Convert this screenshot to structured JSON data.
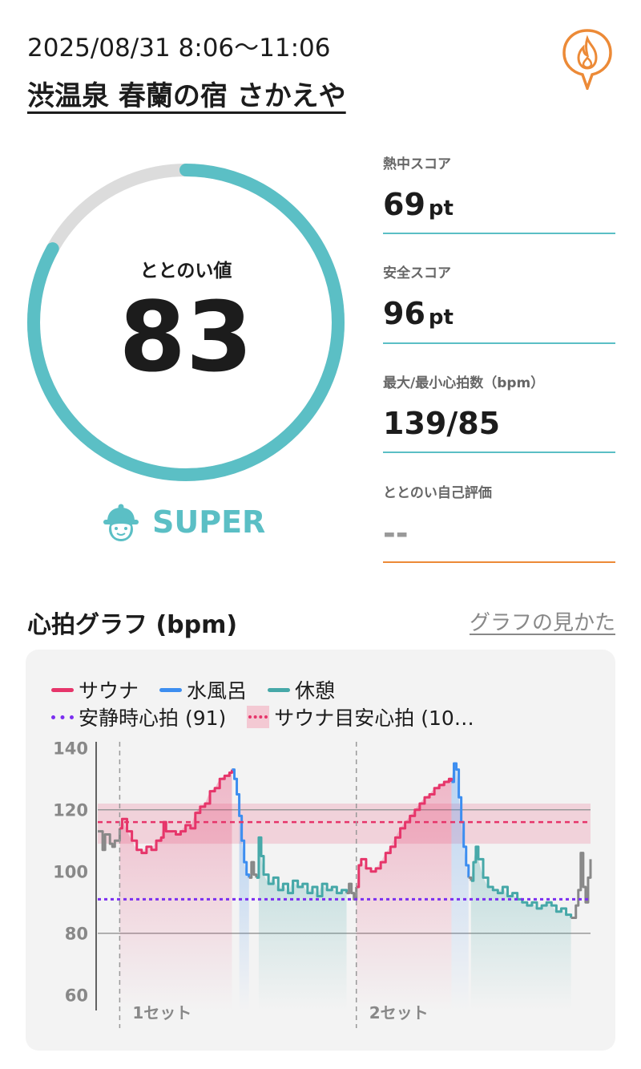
{
  "session": {
    "datetime": "2025/08/31 8:06〜11:06",
    "facility": "渋温泉 春蘭の宿 さかえや"
  },
  "totonoi": {
    "label": "ととのい値",
    "value": "83",
    "fraction": 0.83,
    "rank_label": "SUPER",
    "ring_color": "#5bbfc5",
    "ring_track_color": "#dcdcdc"
  },
  "metrics": [
    {
      "label": "熱中スコア",
      "value": "69",
      "unit": "pt"
    },
    {
      "label": "安全スコア",
      "value": "96",
      "unit": "pt"
    },
    {
      "label": "最大/最小心拍数（bpm）",
      "value": "139/85",
      "unit": ""
    },
    {
      "label": "ととのい自己評価",
      "value": "--",
      "unit": ""
    }
  ],
  "graph": {
    "title": "心拍グラフ (bpm)",
    "help_link": "グラフの見かた"
  },
  "icons": {
    "fire": "fire-pin-icon",
    "rank": "sauna-hat-face-icon"
  },
  "chart_data": {
    "type": "line",
    "ylim": [
      55,
      142
    ],
    "yticks": [
      "140",
      "120",
      "100",
      "80",
      "60"
    ],
    "legend": [
      {
        "name": "サウナ",
        "color": "#e6356a",
        "style": "line"
      },
      {
        "name": "水風呂",
        "color": "#3d8ef0",
        "style": "line"
      },
      {
        "name": "休憩",
        "color": "#46a8a8",
        "style": "line"
      },
      {
        "name": "安静時心拍 (91)",
        "color": "#7b2ff0",
        "style": "dotted"
      },
      {
        "name": "サウナ目安心拍 (10…",
        "color": "#e6356a",
        "style": "band"
      }
    ],
    "resting_hr": 91,
    "sauna_band": [
      109,
      122
    ],
    "sauna_target": 116,
    "reference_lines": [
      120,
      80
    ],
    "set_labels": [
      "1セット",
      "2セット"
    ],
    "series": [
      {
        "name": "pre",
        "color": "#888888",
        "points": [
          [
            0,
            113
          ],
          [
            1,
            107
          ],
          [
            1.5,
            112
          ],
          [
            2.5,
            109
          ],
          [
            3,
            108
          ],
          [
            3.5,
            110
          ],
          [
            4.5,
            114
          ]
        ]
      },
      {
        "name": "サウナ",
        "color": "#e6356a",
        "points": [
          [
            4.5,
            114
          ],
          [
            5,
            117
          ],
          [
            6,
            113
          ],
          [
            7,
            110
          ],
          [
            8,
            107
          ],
          [
            9,
            106
          ],
          [
            10,
            108
          ],
          [
            11,
            107
          ],
          [
            12,
            110
          ],
          [
            13,
            111
          ],
          [
            13.5,
            116
          ],
          [
            14,
            113
          ],
          [
            15,
            113
          ],
          [
            16,
            112
          ],
          [
            17,
            113
          ],
          [
            18,
            115
          ],
          [
            19,
            114
          ],
          [
            20,
            119
          ],
          [
            21,
            121
          ],
          [
            22,
            122
          ],
          [
            23,
            126
          ],
          [
            24,
            127
          ],
          [
            25,
            130
          ],
          [
            26,
            131
          ],
          [
            27,
            132
          ],
          [
            27.5,
            133
          ]
        ]
      },
      {
        "name": "水風呂",
        "color": "#3d8ef0",
        "points": [
          [
            27.5,
            133
          ],
          [
            28,
            130
          ],
          [
            28.5,
            125
          ],
          [
            29,
            118
          ],
          [
            29.5,
            110
          ],
          [
            30,
            103
          ],
          [
            30.5,
            99
          ],
          [
            31,
            98
          ]
        ]
      },
      {
        "name": "mid1",
        "color": "#888888",
        "points": [
          [
            31,
            98
          ],
          [
            31.5,
            103
          ],
          [
            32,
            99
          ],
          [
            32.5,
            98
          ]
        ]
      },
      {
        "name": "休憩",
        "color": "#46a8a8",
        "points": [
          [
            32.5,
            98
          ],
          [
            33,
            111
          ],
          [
            33.5,
            105
          ],
          [
            34,
            99
          ],
          [
            35,
            96
          ],
          [
            36,
            98
          ],
          [
            37,
            94
          ],
          [
            38,
            96
          ],
          [
            39,
            93
          ],
          [
            40,
            97
          ],
          [
            41,
            95
          ],
          [
            42,
            96
          ],
          [
            43,
            93
          ],
          [
            44,
            95
          ],
          [
            45,
            92
          ],
          [
            46,
            96
          ],
          [
            47,
            94
          ],
          [
            48,
            95
          ],
          [
            49,
            93
          ],
          [
            50,
            94
          ],
          [
            51,
            93
          ]
        ]
      },
      {
        "name": "mid2",
        "color": "#888888",
        "points": [
          [
            51,
            93
          ],
          [
            51.5,
            96
          ],
          [
            52,
            93
          ],
          [
            52.5,
            91
          ],
          [
            53,
            95
          ]
        ]
      },
      {
        "name": "サウナ",
        "color": "#e6356a",
        "points": [
          [
            53,
            95
          ],
          [
            53.5,
            102
          ],
          [
            54,
            104
          ],
          [
            55,
            101
          ],
          [
            56,
            100
          ],
          [
            57,
            101
          ],
          [
            58,
            103
          ],
          [
            59,
            106
          ],
          [
            60,
            108
          ],
          [
            61,
            111
          ],
          [
            62,
            114
          ],
          [
            63,
            116
          ],
          [
            64,
            118
          ],
          [
            65,
            120
          ],
          [
            66,
            122
          ],
          [
            67,
            124
          ],
          [
            68,
            125
          ],
          [
            69,
            127
          ],
          [
            70,
            128
          ],
          [
            71,
            129
          ],
          [
            72,
            130
          ],
          [
            72.5,
            129
          ]
        ]
      },
      {
        "name": "水風呂",
        "color": "#3d8ef0",
        "points": [
          [
            72.5,
            129
          ],
          [
            73,
            135
          ],
          [
            73.5,
            133
          ],
          [
            74,
            124
          ],
          [
            74.5,
            116
          ],
          [
            75,
            108
          ],
          [
            75.5,
            102
          ],
          [
            76,
            98
          ]
        ]
      },
      {
        "name": "mid3",
        "color": "#888888",
        "points": [
          [
            76,
            98
          ],
          [
            76.5,
            97
          ]
        ]
      },
      {
        "name": "休憩",
        "color": "#46a8a8",
        "points": [
          [
            76.5,
            97
          ],
          [
            77,
            103
          ],
          [
            77.5,
            108
          ],
          [
            78,
            104
          ],
          [
            79,
            98
          ],
          [
            80,
            95
          ],
          [
            81,
            94
          ],
          [
            82,
            93
          ],
          [
            83,
            95
          ],
          [
            84,
            92
          ],
          [
            85,
            93
          ],
          [
            86,
            91
          ],
          [
            87,
            90
          ],
          [
            88,
            89
          ],
          [
            89,
            90
          ],
          [
            90,
            88
          ],
          [
            91,
            89
          ],
          [
            92,
            90
          ],
          [
            93,
            89
          ],
          [
            94,
            87
          ],
          [
            95,
            88
          ],
          [
            96,
            86
          ],
          [
            97,
            85
          ]
        ]
      },
      {
        "name": "end",
        "color": "#888888",
        "points": [
          [
            97,
            85
          ],
          [
            98,
            89
          ],
          [
            98.5,
            94
          ],
          [
            99,
            106
          ],
          [
            99.5,
            95
          ],
          [
            100,
            90
          ],
          [
            100.5,
            98
          ],
          [
            101,
            104
          ]
        ]
      }
    ],
    "phases": [
      {
        "type": "サウナ",
        "x0": 4.5,
        "x1": 27.5
      },
      {
        "type": "水風呂",
        "x0": 29,
        "x1": 31
      },
      {
        "type": "休憩",
        "x0": 33,
        "x1": 51
      },
      {
        "type": "サウナ",
        "x0": 53,
        "x1": 72.5
      },
      {
        "type": "水風呂",
        "x0": 72.5,
        "x1": 76
      },
      {
        "type": "休憩",
        "x0": 76.5,
        "x1": 97
      }
    ],
    "set_markers": [
      4.5,
      53
    ]
  }
}
